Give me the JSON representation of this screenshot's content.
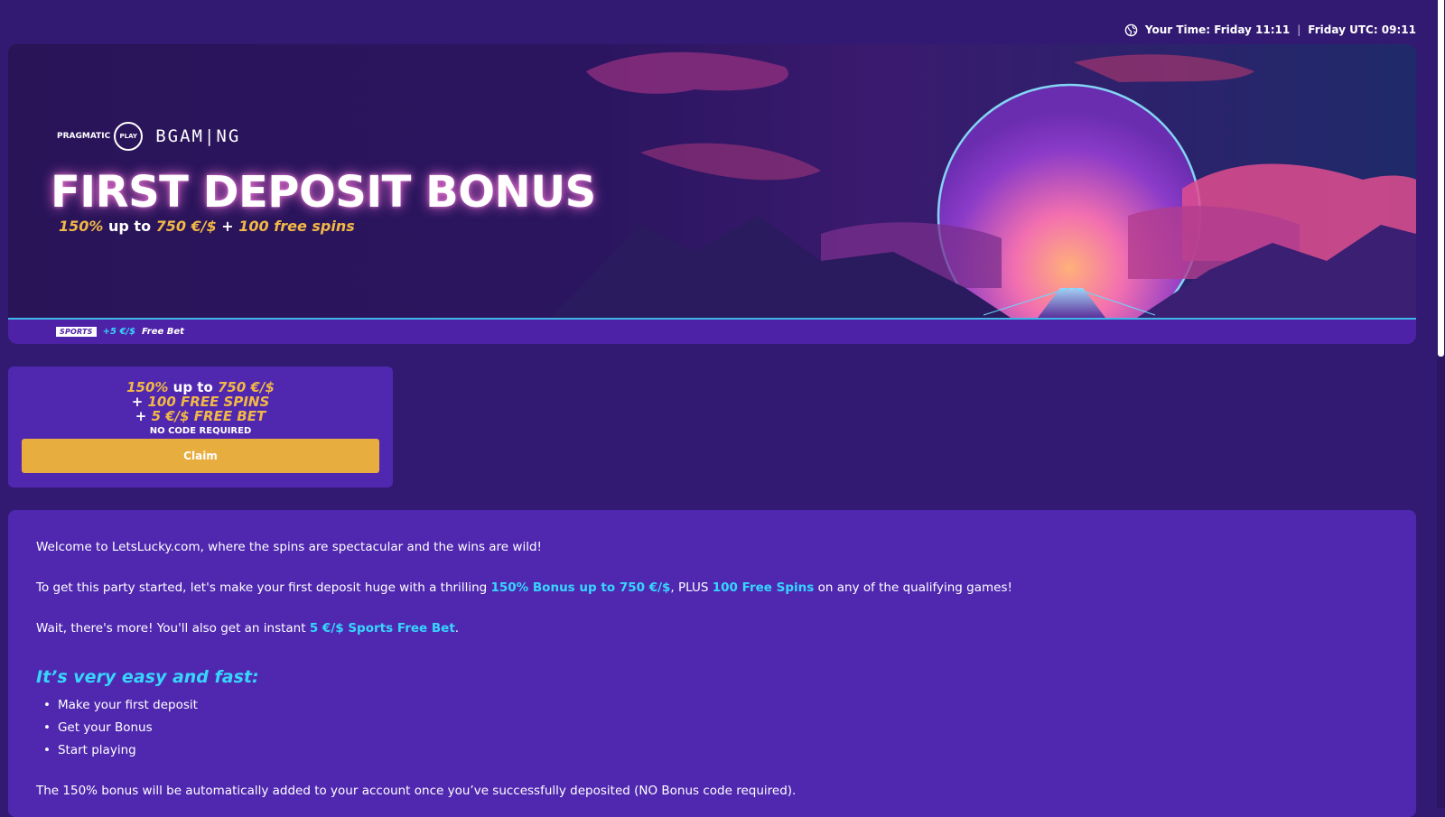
{
  "header": {
    "your_time": "Your Time: Friday 11:11",
    "separator": "|",
    "utc_time": "Friday UTC: 09:11"
  },
  "hero": {
    "providers": {
      "pragmatic_text": "PRAGMATIC",
      "pragmatic_ring": "PLAY",
      "bgaming": "BGAM|NG"
    },
    "title": "FIRST DEPOSIT BONUS",
    "subtitle": {
      "percent": "150%",
      "up_to": " up to ",
      "amount": "750 €/$",
      "plus": " + ",
      "spins": "100 free spins"
    },
    "strip": {
      "logo": "SPORTS",
      "amount": "+5 €/$",
      "label": "Free Bet"
    }
  },
  "offer": {
    "line1_percent": "150%",
    "line1_up_to": " up to ",
    "line1_amount": "750 €/$",
    "line2_plus": "+ ",
    "line2_spins": "100 FREE SPINS",
    "line3_plus": "+ ",
    "line3_bet": "5 €/$ FREE BET",
    "no_code": "NO CODE REQUIRED",
    "claim_label": "Claim"
  },
  "content": {
    "welcome": "Welcome to LetsLucky.com, where the spins are spectacular and the wins are wild!",
    "p2_start": "To get this party started, let's make your first deposit huge with a thrilling ",
    "p2_bonus": "150% Bonus up to 750 €/$",
    "p2_mid": ", PLUS ",
    "p2_spins": "100 Free Spins",
    "p2_end": " on any of the qualifying games!",
    "p3_start": "Wait, there's more! You'll also get an instant ",
    "p3_bet": "5 €/$ Sports Free Bet",
    "p3_end": ".",
    "easy_heading": "It’s very easy and fast:",
    "steps": [
      "Make your first deposit",
      "Get your Bonus",
      "Start playing"
    ],
    "footer": "The 150% bonus will be automatically added to your account once you’ve successfully deposited (NO Bonus code required)."
  },
  "colors": {
    "page_bg": "#321a72",
    "card_bg": "#5028b0",
    "gold": "#f2b845",
    "claim": "#e8ad3f",
    "highlight": "#36d6ff"
  }
}
